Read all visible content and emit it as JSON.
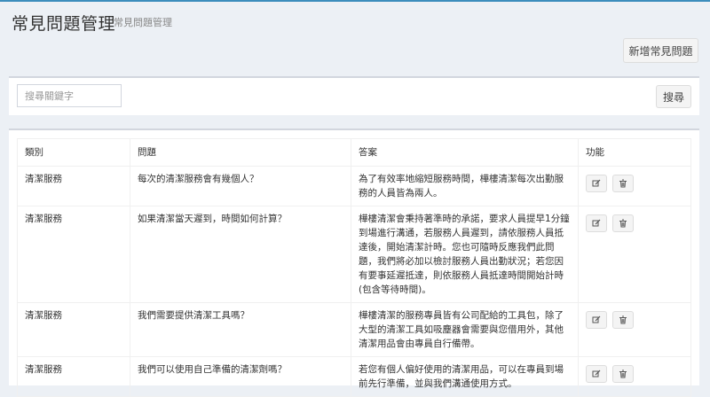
{
  "header": {
    "title": "常見問題管理",
    "subtitle": "常見問題管理",
    "add_button": "新增常見問題"
  },
  "search": {
    "placeholder": "搜尋關鍵字",
    "value": "",
    "button": "搜尋"
  },
  "table": {
    "columns": [
      "類別",
      "問題",
      "答案",
      "功能"
    ],
    "rows": [
      {
        "category": "清潔服務",
        "question": "每次的清潔服務會有幾個人？",
        "answer": "為了有效率地縮短服務時間，樺樓清潔每次出勤服務的人員皆為兩人。"
      },
      {
        "category": "清潔服務",
        "question": "如果清潔當天遲到，時間如何計算？",
        "answer": "樺樓清潔會秉持著準時的承諾，要求人員提早1分鐘到場進行溝通，若服務人員遲到，請依服務人員抵達後，開始清潔計時。您也可隨時反應我們此問題，我們將必加以檢討服務人員出勤狀況；若您因有要事延遲抵達，則依服務人員抵達時間開始計時(包含等待時間)。"
      },
      {
        "category": "清潔服務",
        "question": "我們需要提供清潔工具嗎？",
        "answer": "樺樓清潔的服務專員皆有公司配給的工具包，除了大型的清潔工具如吸塵器會需要與您借用外，其他清潔用品會由專員自行備帶。"
      },
      {
        "category": "清潔服務",
        "question": "我們可以使用自己準備的清潔劑嗎？",
        "answer": "若您有個人偏好使用的清潔用品，可以在專員到場前先行準備，並與我們溝通使用方式。"
      }
    ]
  },
  "icons": {
    "edit": "edit-icon",
    "delete": "trash-icon"
  }
}
